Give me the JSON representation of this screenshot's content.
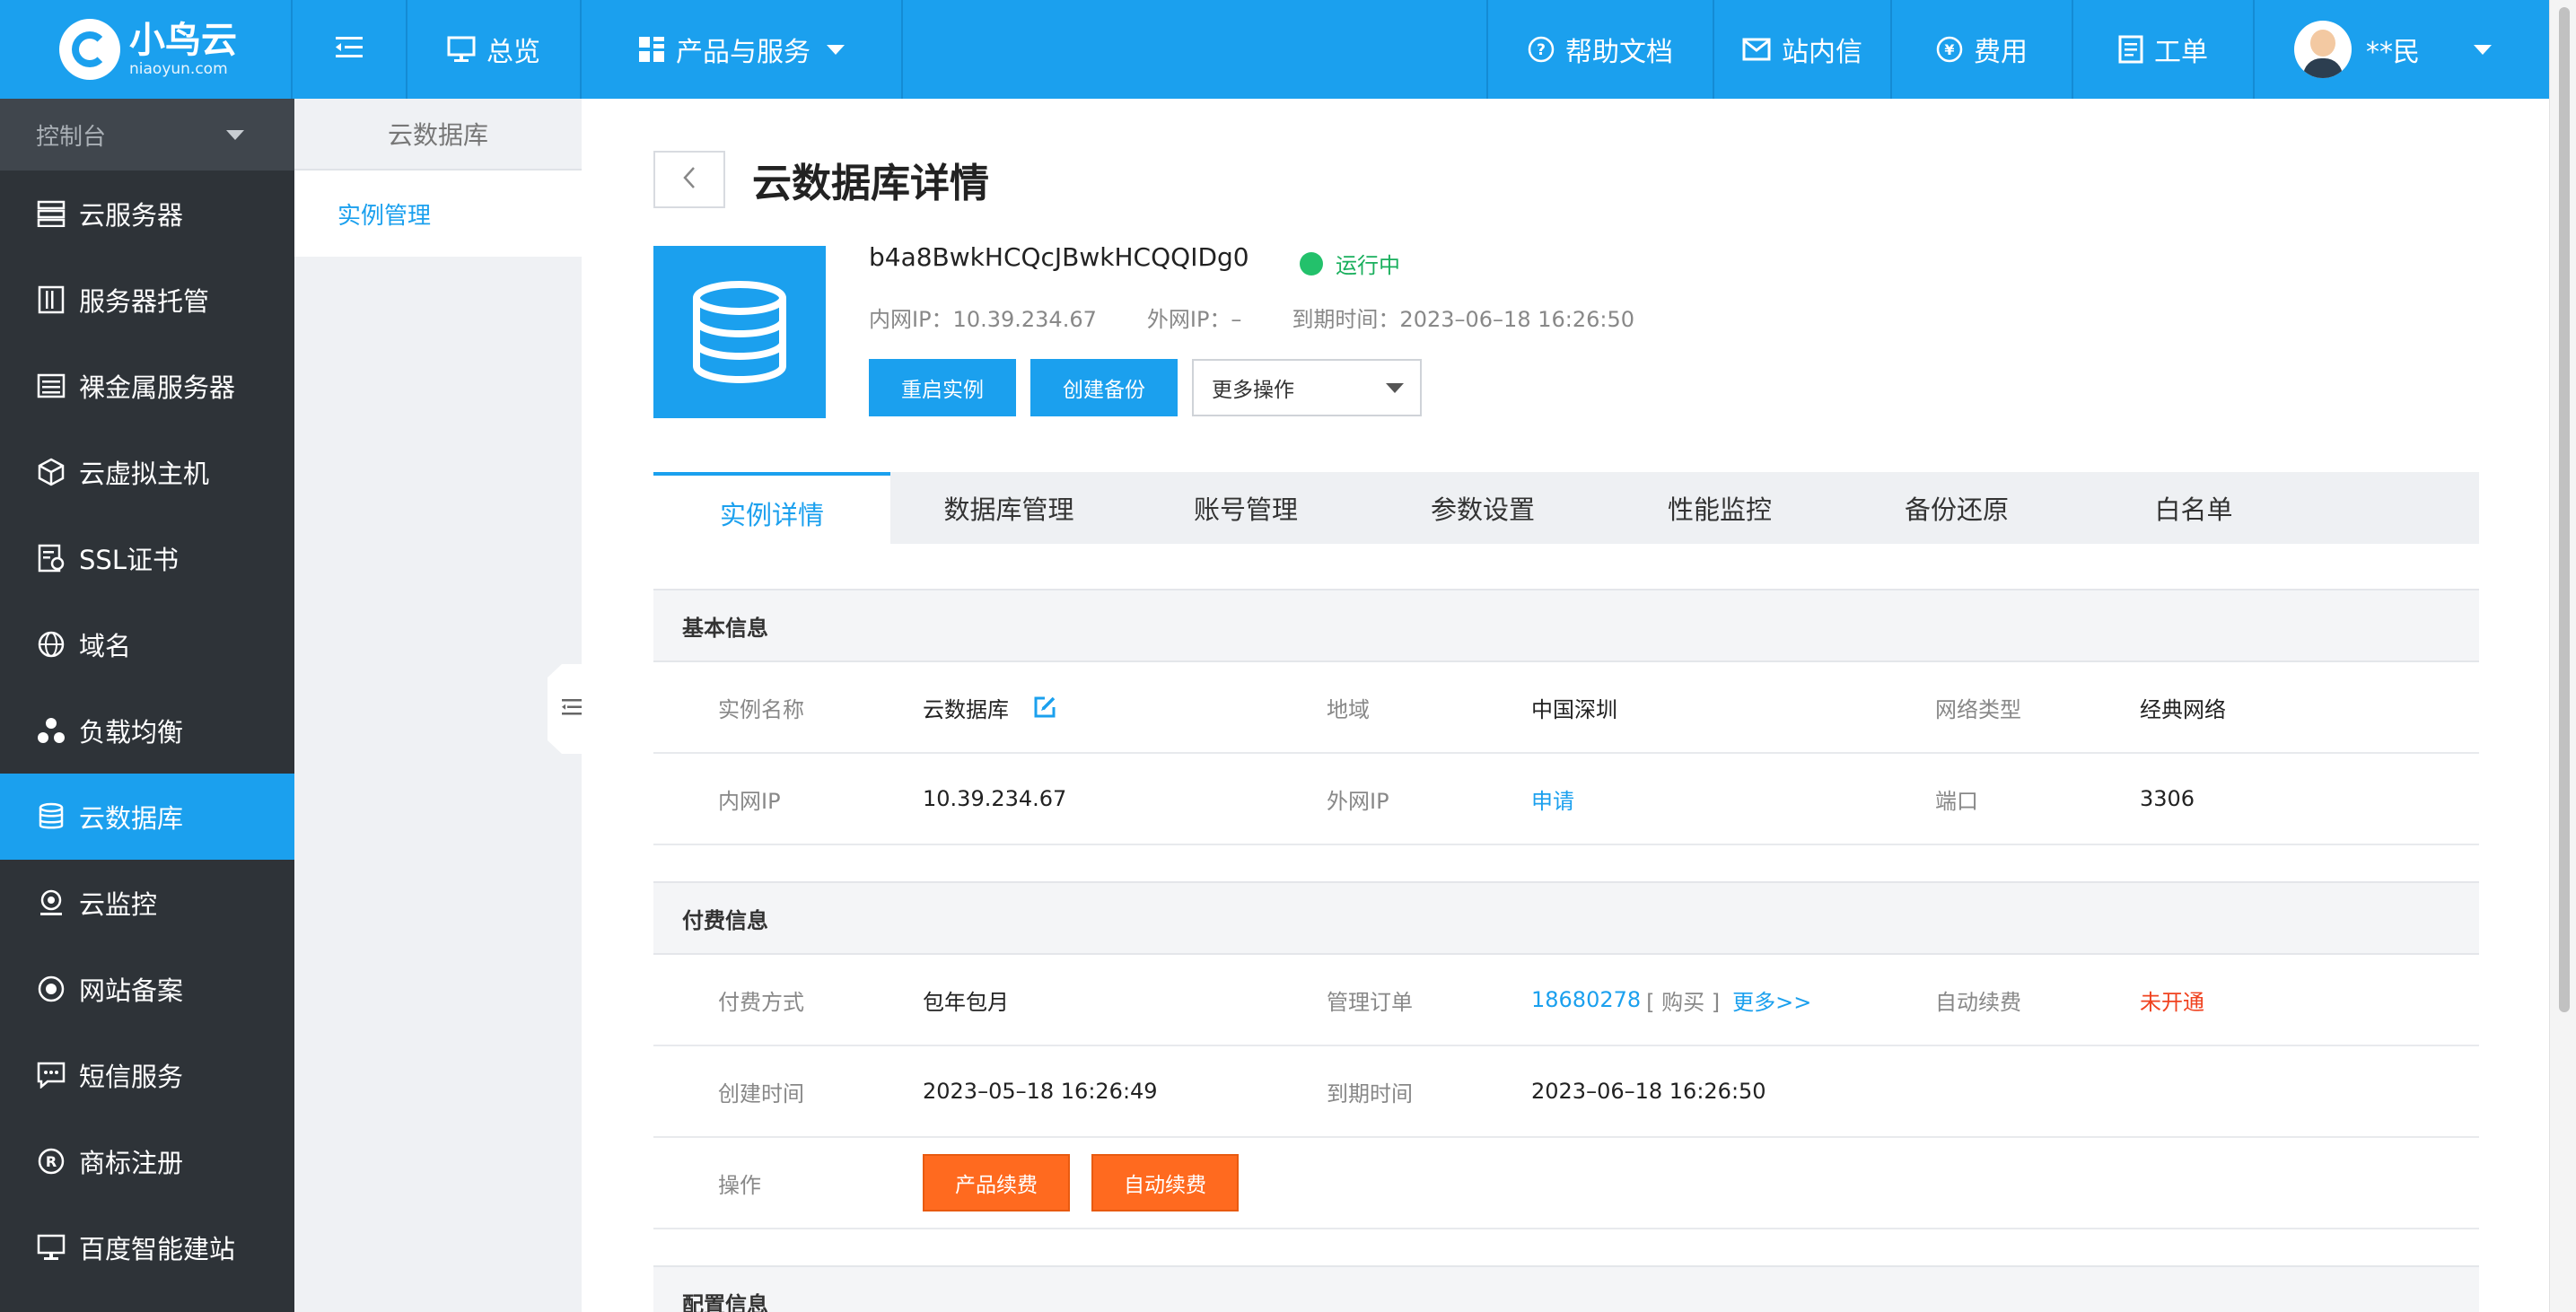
{
  "brand": {
    "name": "小鸟云",
    "domain": "niaoyun.com"
  },
  "topbar": {
    "overview": "总览",
    "products": "产品与服务",
    "help": "帮助文档",
    "messages": "站内信",
    "fees": "费用",
    "tickets": "工单",
    "user": "**民"
  },
  "sidebar": {
    "console": "控制台",
    "items": [
      {
        "label": "云服务器",
        "icon": "server-icon"
      },
      {
        "label": "服务器托管",
        "icon": "hosting-icon"
      },
      {
        "label": "裸金属服务器",
        "icon": "bare-metal-icon"
      },
      {
        "label": "云虚拟主机",
        "icon": "cube-icon"
      },
      {
        "label": "SSL证书",
        "icon": "certificate-icon"
      },
      {
        "label": "域名",
        "icon": "globe-icon"
      },
      {
        "label": "负载均衡",
        "icon": "load-balance-icon"
      },
      {
        "label": "云数据库",
        "icon": "database-icon",
        "active": true
      },
      {
        "label": "云监控",
        "icon": "monitor-icon"
      },
      {
        "label": "网站备案",
        "icon": "record-icon"
      },
      {
        "label": "短信服务",
        "icon": "sms-icon"
      },
      {
        "label": "商标注册",
        "icon": "trademark-icon"
      },
      {
        "label": "百度智能建站",
        "icon": "site-builder-icon"
      }
    ]
  },
  "subnav": {
    "title": "云数据库",
    "item": "实例管理"
  },
  "page": {
    "title": "云数据库详情"
  },
  "instance": {
    "id": "b4a8BwkHCQcJBwkHCQQIDg0",
    "status": "运行中",
    "status_color": "#23c16b",
    "intranet_ip": "内网IP：10.39.234.67",
    "public_ip": "外网IP：–",
    "expire": "到期时间：2023–06–18 16:26:50"
  },
  "actions": {
    "restart": "重启实例",
    "backup": "创建备份",
    "more": "更多操作"
  },
  "tabs": [
    "实例详情",
    "数据库管理",
    "账号管理",
    "参数设置",
    "性能监控",
    "备份还原",
    "白名单"
  ],
  "basic": {
    "title": "基本信息",
    "name_label": "实例名称",
    "name_value": "云数据库",
    "region_label": "地域",
    "region_value": "中国深圳",
    "net_label": "网络类型",
    "net_value": "经典网络",
    "ip_label": "内网IP",
    "ip_value": "10.39.234.67",
    "pubip_label": "外网IP",
    "pubip_value": "申请",
    "port_label": "端口",
    "port_value": "3306"
  },
  "billing": {
    "title": "付费信息",
    "pay_label": "付费方式",
    "pay_value": "包年包月",
    "order_label": "管理订单",
    "order_id": "18680278",
    "order_buy": "[ 购买 ]",
    "order_more": "更多>>",
    "auto_label": "自动续费",
    "auto_value": "未开通",
    "created_label": "创建时间",
    "created_value": "2023–05–18 16:26:49",
    "expire_label": "到期时间",
    "expire_value": "2023–06–18 16:26:50",
    "op_label": "操作",
    "renew": "产品续费",
    "auto_renew": "自动续费"
  },
  "config": {
    "title": "配置信息"
  },
  "colors": {
    "accent": "#1ba0ee",
    "sidebar": "#2e3338",
    "orange": "#ff6a1f",
    "danger": "#f0421f"
  }
}
